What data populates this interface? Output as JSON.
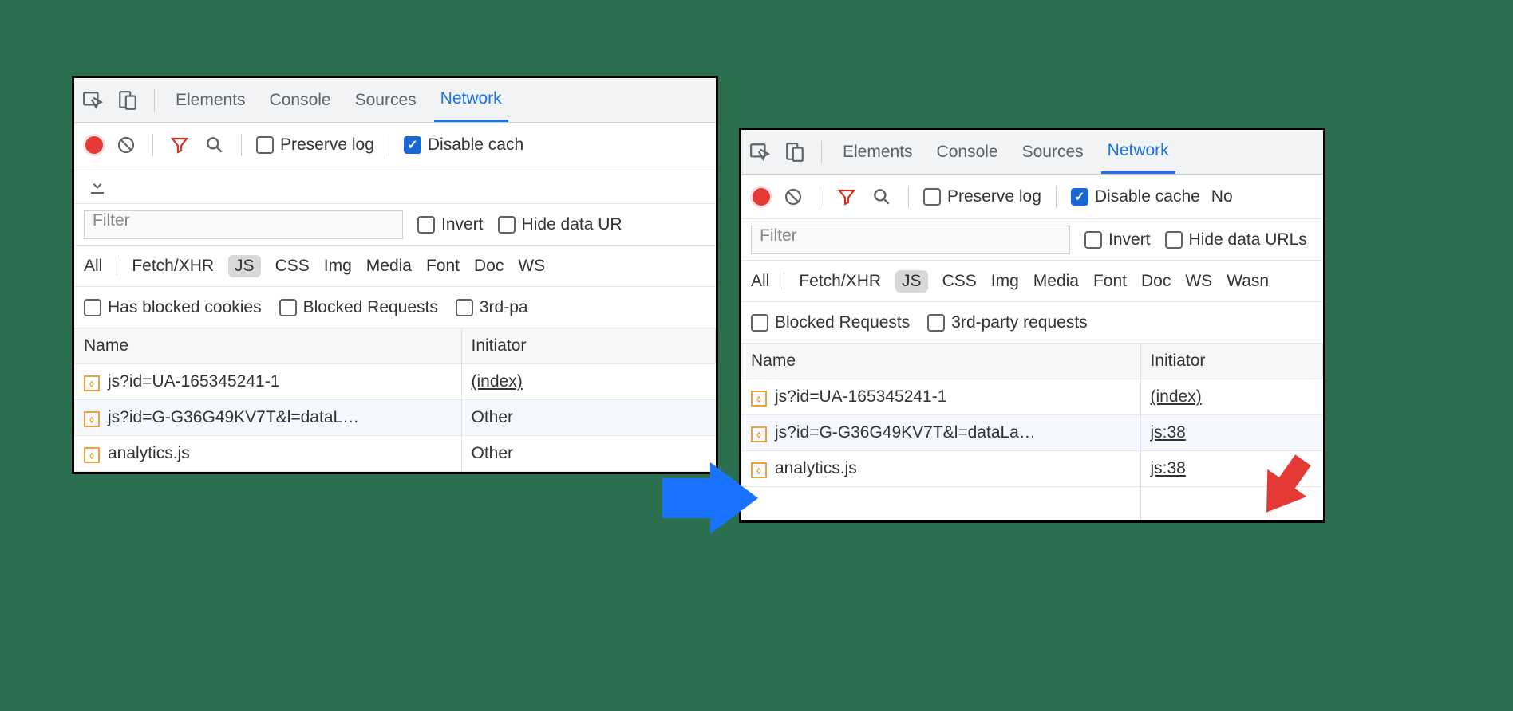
{
  "tabs": {
    "elements": "Elements",
    "console": "Console",
    "sources": "Sources",
    "network": "Network"
  },
  "toolbar": {
    "preserve": "Preserve log",
    "disable_cache": "Disable cache",
    "disable_cache_cut": "Disable cach",
    "no_frag": "No"
  },
  "filter": {
    "placeholder": "Filter",
    "invert": "Invert",
    "hide_urls": "Hide data URLs",
    "hide_urls_cut": "Hide data UR"
  },
  "types": {
    "all": "All",
    "xhr": "Fetch/XHR",
    "js": "JS",
    "css": "CSS",
    "img": "Img",
    "media": "Media",
    "font": "Font",
    "doc": "Doc",
    "ws": "WS",
    "wasm": "Wasn"
  },
  "opts": {
    "blocked_cookies": "Has blocked cookies",
    "blocked_req": "Blocked Requests",
    "third_cut": "3rd-pa",
    "third": "3rd-party requests"
  },
  "headers": {
    "name": "Name",
    "initiator": "Initiator"
  },
  "left_rows": [
    {
      "name": "js?id=UA-165345241-1",
      "initiator": "(index)",
      "u": true
    },
    {
      "name": "js?id=G-G36G49KV7T&l=dataL…",
      "initiator": "Other",
      "u": false
    },
    {
      "name": "analytics.js",
      "initiator": "Other",
      "u": false
    }
  ],
  "right_rows": [
    {
      "name": "js?id=UA-165345241-1",
      "initiator": "(index)",
      "u": true
    },
    {
      "name": "js?id=G-G36G49KV7T&l=dataLa…",
      "initiator": "js:38",
      "u": true
    },
    {
      "name": "analytics.js",
      "initiator": "js:38",
      "u": true
    }
  ],
  "icons": {
    "js": "⧫"
  }
}
